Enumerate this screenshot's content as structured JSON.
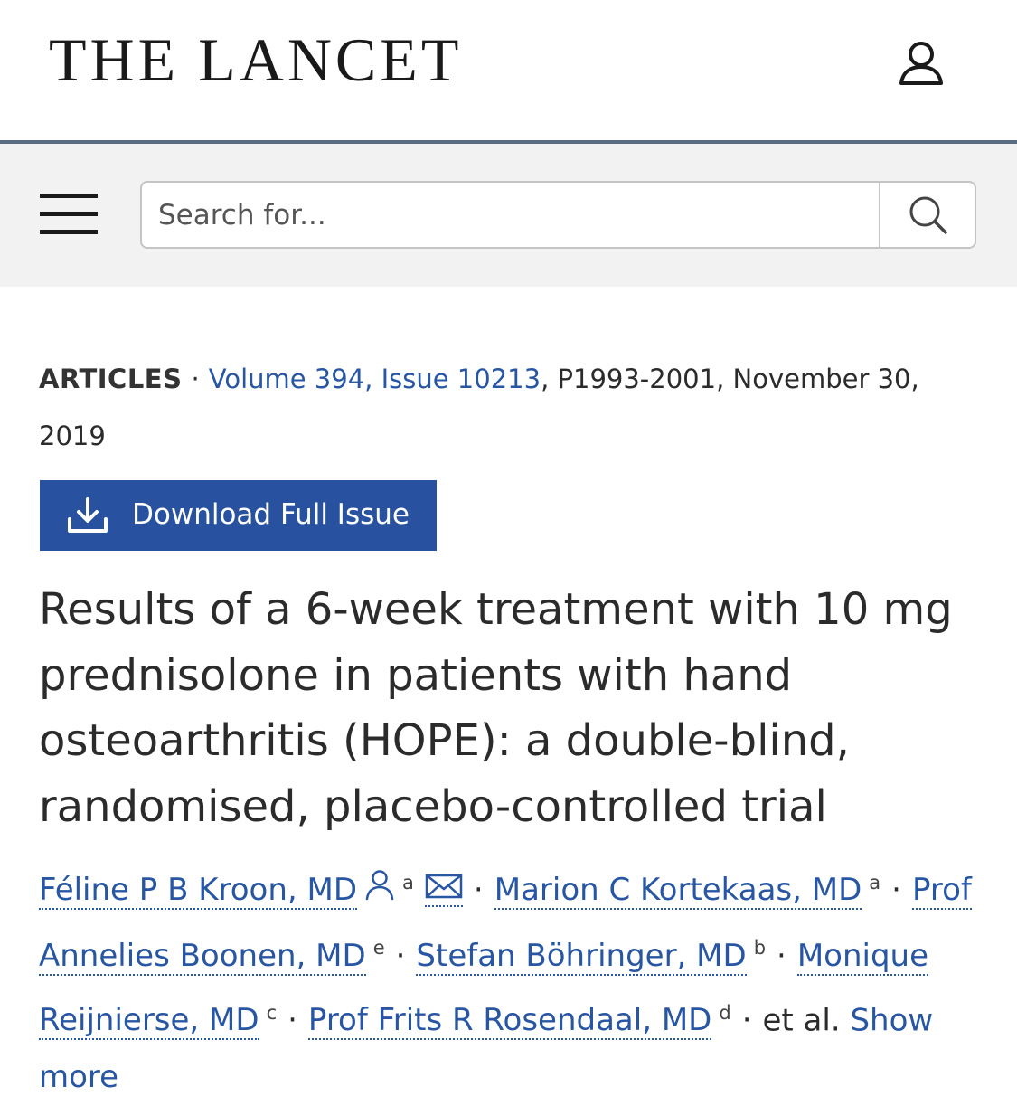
{
  "header": {
    "logo": "THE LANCET"
  },
  "search": {
    "placeholder": "Search for..."
  },
  "article": {
    "type": "ARTICLES",
    "separator": "·",
    "issue_link": "Volume 394, Issue 10213",
    "pages_date": ", P1993-2001, November 30, 2019",
    "download_label": "Download Full Issue",
    "title": "Results of a 6-week treatment with 10 mg prednisolone in patients with hand osteoarthritis (HOPE): a double-blind, randomised, placebo-controlled trial",
    "authors": [
      {
        "name": "Féline P B Kroon, MD",
        "aff": "a"
      },
      {
        "name": "Marion C Kortekaas, MD",
        "aff": "a"
      },
      {
        "name": "Prof Annelies Boonen, MD",
        "aff": "e"
      },
      {
        "name": "Stefan Böhringer, MD",
        "aff": "b"
      },
      {
        "name": "Monique Reijnierse, MD",
        "aff": "c"
      },
      {
        "name": "Prof Frits R Rosendaal, MD",
        "aff": "d"
      }
    ],
    "et_al": "et al.",
    "show_more": "Show more"
  }
}
